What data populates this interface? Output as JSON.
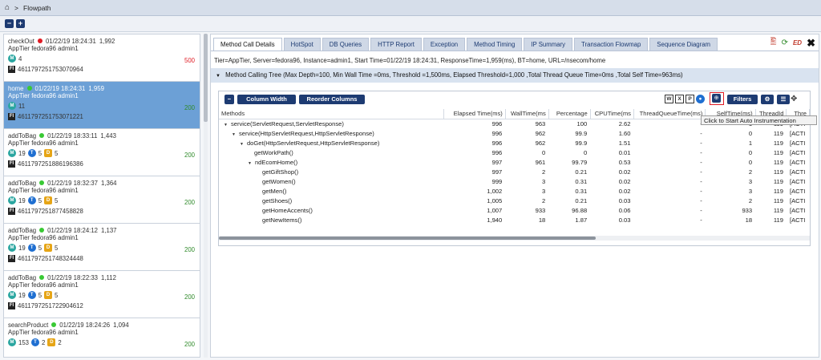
{
  "breadcrumb": {
    "home_icon": "home-icon",
    "separator": ">",
    "title": "Flowpath"
  },
  "toolbar": {
    "collapse_icon": "minus-icon",
    "expand_icon": "plus-icon"
  },
  "flowpaths": [
    {
      "name": "checkOut",
      "status": "red",
      "datetime": "01/22/19 18:24:31",
      "duration": "1,992",
      "tier": "AppTier",
      "server": "fedora96",
      "instance": "admin1",
      "badges": [
        {
          "type": "M",
          "value": "4"
        }
      ],
      "count": "500",
      "count_color": "red",
      "id": "4611797251753070964"
    },
    {
      "name": "home",
      "status": "green",
      "datetime": "01/22/19 18:24:31",
      "duration": "1,959",
      "tier": "AppTier",
      "server": "fedora96",
      "instance": "admin1",
      "badges": [
        {
          "type": "M",
          "value": "11"
        }
      ],
      "count": "200",
      "count_color": "green",
      "id": "4611797251753071221",
      "selected": true
    },
    {
      "name": "addToBag",
      "status": "green",
      "datetime": "01/22/19 18:33:11",
      "duration": "1,443",
      "tier": "AppTier",
      "server": "fedora96",
      "instance": "admin1",
      "badges": [
        {
          "type": "M",
          "value": "19"
        },
        {
          "type": "T",
          "value": "5"
        },
        {
          "type": "D",
          "value": "5"
        }
      ],
      "count": "200",
      "count_color": "green",
      "id": "4611797251886196386"
    },
    {
      "name": "addToBag",
      "status": "green",
      "datetime": "01/22/19 18:32:37",
      "duration": "1,364",
      "tier": "AppTier",
      "server": "fedora96",
      "instance": "admin1",
      "badges": [
        {
          "type": "M",
          "value": "19"
        },
        {
          "type": "T",
          "value": "5"
        },
        {
          "type": "D",
          "value": "5"
        }
      ],
      "count": "200",
      "count_color": "green",
      "id": "4611797251877458828"
    },
    {
      "name": "addToBag",
      "status": "green",
      "datetime": "01/22/19 18:24:12",
      "duration": "1,137",
      "tier": "AppTier",
      "server": "fedora96",
      "instance": "admin1",
      "badges": [
        {
          "type": "M",
          "value": "19"
        },
        {
          "type": "T",
          "value": "5"
        },
        {
          "type": "D",
          "value": "5"
        }
      ],
      "count": "200",
      "count_color": "green",
      "id": "4611797251748324448"
    },
    {
      "name": "addToBag",
      "status": "green",
      "datetime": "01/22/19 18:22:33",
      "duration": "1,112",
      "tier": "AppTier",
      "server": "fedora96",
      "instance": "admin1",
      "badges": [
        {
          "type": "M",
          "value": "19"
        },
        {
          "type": "T",
          "value": "5"
        },
        {
          "type": "D",
          "value": "5"
        }
      ],
      "count": "200",
      "count_color": "green",
      "id": "4611797251722904612"
    },
    {
      "name": "searchProduct",
      "status": "green",
      "datetime": "01/22/19 18:24:26",
      "duration": "1,094",
      "tier": "AppTier",
      "server": "fedora96",
      "instance": "admin1",
      "badges": [
        {
          "type": "M",
          "value": "153"
        },
        {
          "type": "T",
          "value": "2"
        },
        {
          "type": "D",
          "value": "2"
        }
      ],
      "count": "200",
      "count_color": "green",
      "id": ""
    }
  ],
  "tabs": [
    "Method Call Details",
    "HotSpot",
    "DB Queries",
    "HTTP Report",
    "Exception",
    "Method Timing",
    "IP Summary",
    "Transaction Flowmap",
    "Sequence Diagram"
  ],
  "info_line": "Tier=AppTier, Server=fedora96, Instance=admin1, Start Time=01/22/19 18:24:31, ResponseTime=1,959(ms), BT=home, URL=/nsecom/home",
  "tree_header": "Method Calling Tree (Max Depth=100, Min Wall Time =0ms, Threshold =1,500ms, Elapsed Threshold=1,000 ,Total Thread Queue Time=0ms ,Total Self Time=963ms)",
  "inner_toolbar": {
    "column_width": "Column Width",
    "reorder_columns": "Reorder Columns",
    "filters": "Filters"
  },
  "tooltip": "Click to Start Auto Instrumentation",
  "table": {
    "headers": [
      "Methods",
      "Elapsed Time(ms)",
      "WallTime(ms",
      "Percentage",
      "CPUTime(ms",
      "ThreadQueueTime(ms)",
      "SelfTime(ms)",
      "ThreadId",
      "Thre"
    ],
    "rows": [
      {
        "method": "service(ServletRequest,ServletResponse)",
        "indent": 0,
        "expand": true,
        "elapsed": "996",
        "wall": "963",
        "pct": "100",
        "cpu": "2.62",
        "queue": "-",
        "self": "1",
        "tid": "119",
        "state": "[ACTI"
      },
      {
        "method": "service(HttpServletRequest,HttpServletResponse)",
        "indent": 1,
        "expand": true,
        "elapsed": "996",
        "wall": "962",
        "pct": "99.9",
        "cpu": "1.60",
        "queue": "-",
        "self": "0",
        "tid": "119",
        "state": "[ACTI"
      },
      {
        "method": "doGet(HttpServletRequest,HttpServletResponse)",
        "indent": 2,
        "expand": true,
        "elapsed": "996",
        "wall": "962",
        "pct": "99.9",
        "cpu": "1.51",
        "queue": "-",
        "self": "1",
        "tid": "119",
        "state": "[ACTI"
      },
      {
        "method": "getWorkPath()",
        "indent": 3,
        "expand": false,
        "elapsed": "996",
        "wall": "0",
        "pct": "0",
        "cpu": "0.01",
        "queue": "-",
        "self": "0",
        "tid": "119",
        "state": "[ACTI"
      },
      {
        "method": "ndEcomHome()",
        "indent": 3,
        "expand": true,
        "elapsed": "997",
        "wall": "961",
        "pct": "99.79",
        "cpu": "0.53",
        "queue": "-",
        "self": "0",
        "tid": "119",
        "state": "[ACTI"
      },
      {
        "method": "getGiftShop()",
        "indent": 4,
        "expand": false,
        "elapsed": "997",
        "wall": "2",
        "pct": "0.21",
        "cpu": "0.02",
        "queue": "-",
        "self": "2",
        "tid": "119",
        "state": "[ACTI"
      },
      {
        "method": "getWomen()",
        "indent": 4,
        "expand": false,
        "elapsed": "999",
        "wall": "3",
        "pct": "0.31",
        "cpu": "0.02",
        "queue": "-",
        "self": "3",
        "tid": "119",
        "state": "[ACTI"
      },
      {
        "method": "getMen()",
        "indent": 4,
        "expand": false,
        "elapsed": "1,002",
        "wall": "3",
        "pct": "0.31",
        "cpu": "0.02",
        "queue": "-",
        "self": "3",
        "tid": "119",
        "state": "[ACTI"
      },
      {
        "method": "getShoes()",
        "indent": 4,
        "expand": false,
        "elapsed": "1,005",
        "wall": "2",
        "pct": "0.21",
        "cpu": "0.03",
        "queue": "-",
        "self": "2",
        "tid": "119",
        "state": "[ACTI"
      },
      {
        "method": "getHomeAccents()",
        "indent": 4,
        "expand": false,
        "elapsed": "1,007",
        "wall": "933",
        "pct": "96.88",
        "cpu": "0.06",
        "queue": "-",
        "self": "933",
        "tid": "119",
        "state": "[ACTI"
      },
      {
        "method": "getNewItems()",
        "indent": 4,
        "expand": false,
        "elapsed": "1,940",
        "wall": "18",
        "pct": "1.87",
        "cpu": "0.03",
        "queue": "-",
        "self": "18",
        "tid": "119",
        "state": "[ACTI"
      }
    ]
  },
  "colors": {
    "accent": "#1d3b72",
    "selected_row": "#6ca0d6",
    "tree_header_bg": "#d9e3f0",
    "status_red": "#e01b24",
    "status_green": "#39c934"
  }
}
